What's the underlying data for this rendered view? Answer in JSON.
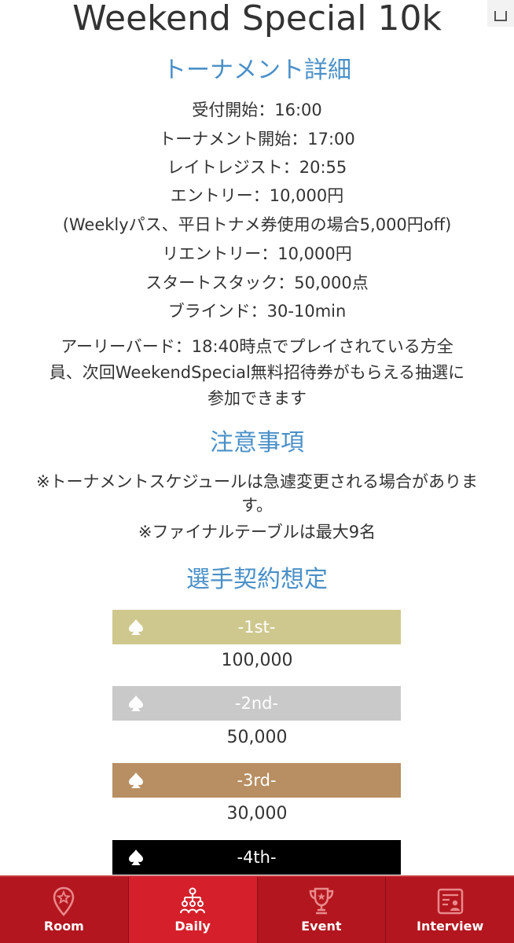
{
  "title": "Weekend Special 10k",
  "details": {
    "heading": "トーナメント詳細",
    "lines": [
      "受付開始：16:00",
      "トーナメント開始：17:00",
      "レイトレジスト：20:55",
      "エントリー：10,000円",
      "(Weeklyパス、平日トナメ券使用の場合5,000円off)",
      "リエントリー：10,000円",
      "スタートスタック：50,000点",
      "ブラインド：30-10min"
    ],
    "early_bird": [
      "アーリーバード：18:40時点でプレイされている方全",
      "員、次回WeekendSpecial無料招待券がもらえる抽選に",
      "参加できます"
    ]
  },
  "notes": {
    "heading": "注意事項",
    "lines": [
      "※トーナメントスケジュールは急遽変更される場合がありま",
      "す。",
      "※ファイナルテーブルは最大9名"
    ]
  },
  "prizes": {
    "heading": "選手契約想定",
    "items": [
      {
        "label": "-1st-",
        "value": "100,000",
        "color": "#cfc88e"
      },
      {
        "label": "-2nd-",
        "value": "50,000",
        "color": "#c9c9c9"
      },
      {
        "label": "-3rd-",
        "value": "30,000",
        "color": "#b88f63"
      },
      {
        "label": "-4th-",
        "value": "",
        "color": "#000000"
      }
    ]
  },
  "tabbar": {
    "colors": {
      "bar": "#b3161f",
      "active": "#d5202b"
    },
    "tabs": [
      {
        "label": "Room",
        "icon": "map-pin-star-icon",
        "active": false
      },
      {
        "label": "Daily",
        "icon": "tournament-bracket-icon",
        "active": true
      },
      {
        "label": "Event",
        "icon": "trophy-icon",
        "active": false
      },
      {
        "label": "Interview",
        "icon": "news-person-icon",
        "active": false
      }
    ]
  }
}
